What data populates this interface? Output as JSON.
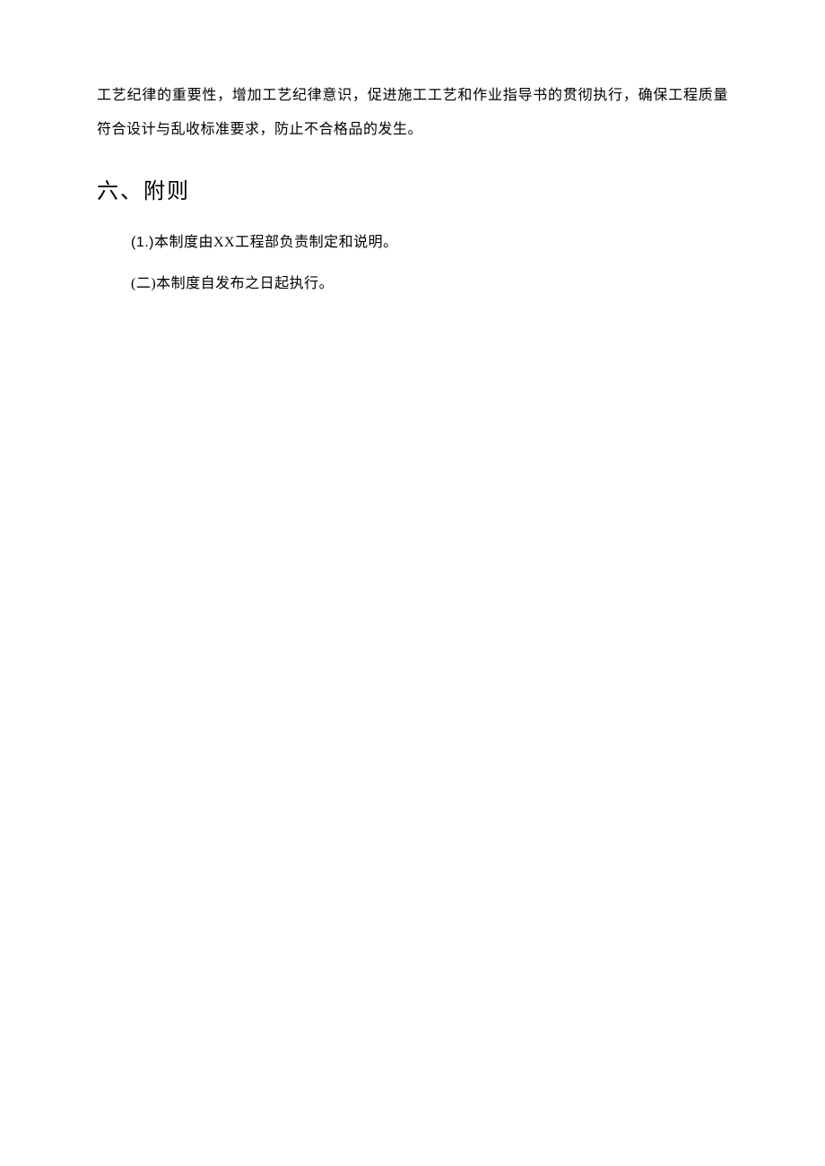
{
  "paragraph1": "工艺纪律的重要性，增加工艺纪律意识，促进施工工艺和作业指导书的贯彻执行，确保工程质量符合设计与乱收标准要求，防止不合格品的发生。",
  "heading": "六、附则",
  "items": [
    {
      "marker": "(1.)",
      "content": "本制度由XX工程部负责制定和说明。"
    },
    {
      "marker": "(二)",
      "content": "本制度自发布之日起执行。"
    }
  ]
}
